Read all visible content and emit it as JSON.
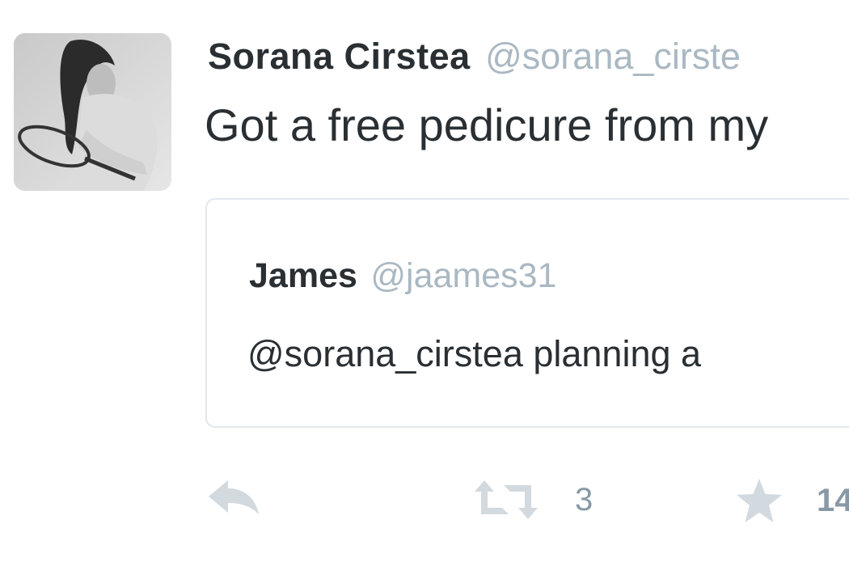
{
  "tweet": {
    "author_name": "Sorana Cirstea",
    "author_handle": "@sorana_cirste",
    "text": "Got a free pedicure from my",
    "quote": {
      "name": "James",
      "handle": "@jaames31",
      "text": "@sorana_cirstea planning a"
    },
    "actions": {
      "reply_icon": "reply-icon",
      "retweet_icon": "retweet-icon",
      "retweet_count": "3",
      "favorite_icon": "star-icon",
      "favorite_count": "14"
    }
  },
  "colors": {
    "text": "#292f33",
    "handle": "#aab8c2",
    "action": "#8899a6",
    "border": "#e1e8ed"
  }
}
